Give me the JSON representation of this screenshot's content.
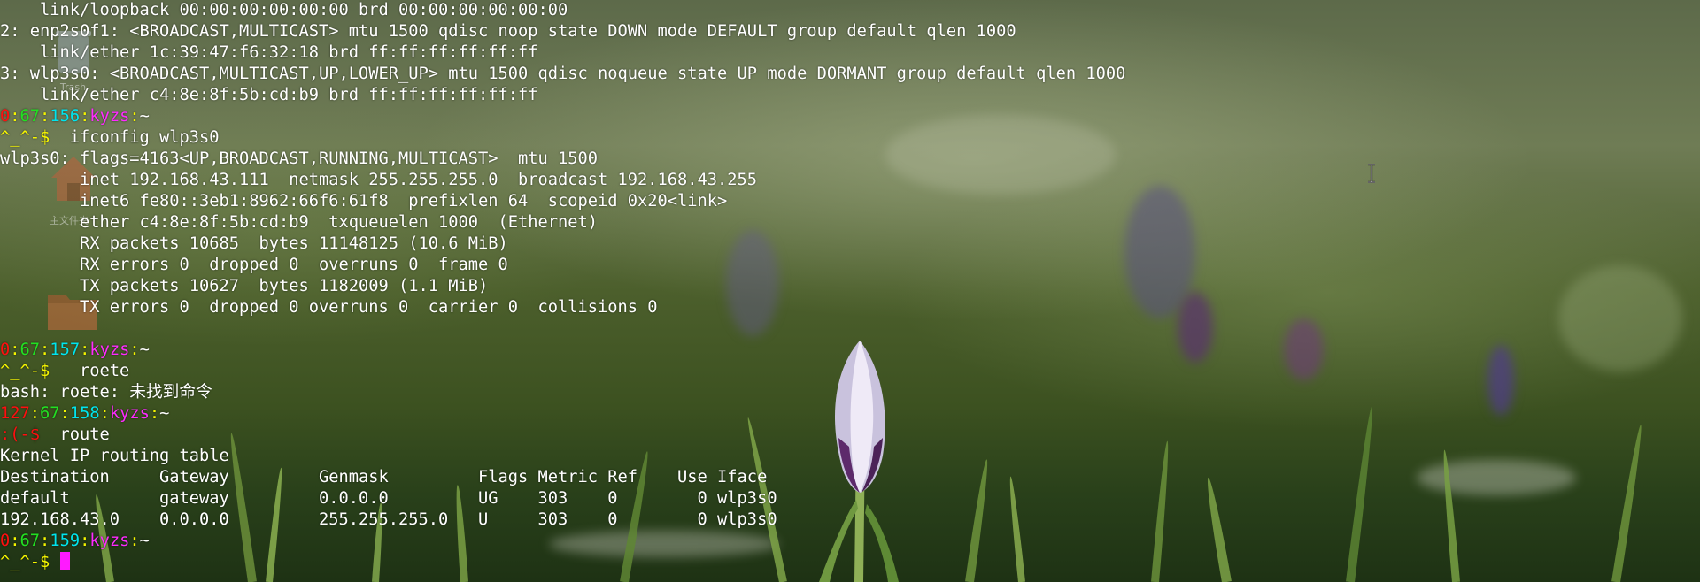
{
  "desktop": {
    "icons": [
      {
        "name": "trash-icon",
        "label": "Trash"
      },
      {
        "name": "home-folder-icon",
        "label": "主文件夹"
      },
      {
        "name": "folder-icon",
        "label": ""
      }
    ]
  },
  "prompt": {
    "host": "kyzs",
    "dir": "~",
    "sep": ":",
    "happy": "^_^-$",
    "sad": ":(-$"
  },
  "terminal": {
    "l0": "    link/loopback 00:00:00:00:00:00 brd 00:00:00:00:00:00",
    "l1": "2: enp2s0f1: <BROADCAST,MULTICAST> mtu 1500 qdisc noop state DOWN mode DEFAULT group default qlen 1000",
    "l2": "    link/ether 1c:39:47:f6:32:18 brd ff:ff:ff:ff:ff:ff",
    "l3": "3: wlp3s0: <BROADCAST,MULTICAST,UP,LOWER_UP> mtu 1500 qdisc noqueue state UP mode DORMANT group default qlen 1000",
    "l4": "    link/ether c4:8e:8f:5b:cd:b9 brd ff:ff:ff:ff:ff:ff",
    "p1": {
      "status": "0",
      "jobs": "67",
      "hist": "156"
    },
    "c1": "  ifconfig wlp3s0",
    "o1": "wlp3s0: flags=4163<UP,BROADCAST,RUNNING,MULTICAST>  mtu 1500",
    "o2": "        inet 192.168.43.111  netmask 255.255.255.0  broadcast 192.168.43.255",
    "o3": "        inet6 fe80::3eb1:8962:66f6:61f8  prefixlen 64  scopeid 0x20<link>",
    "o4": "        ether c4:8e:8f:5b:cd:b9  txqueuelen 1000  (Ethernet)",
    "o5": "        RX packets 10685  bytes 11148125 (10.6 MiB)",
    "o6": "        RX errors 0  dropped 0  overruns 0  frame 0",
    "o7": "        TX packets 10627  bytes 1182009 (1.1 MiB)",
    "o8": "        TX errors 0  dropped 0 overruns 0  carrier 0  collisions 0",
    "p2": {
      "status": "0",
      "jobs": "67",
      "hist": "157"
    },
    "c2": "   roete",
    "o9": "bash: roete: 未找到命令",
    "p3": {
      "status": "127",
      "jobs": "67",
      "hist": "158"
    },
    "c3": "  route",
    "r0": "Kernel IP routing table",
    "r1": "Destination     Gateway         Genmask         Flags Metric Ref    Use Iface",
    "r2": "default         gateway         0.0.0.0         UG    303    0        0 wlp3s0",
    "r3": "192.168.43.0    0.0.0.0         255.255.255.0   U     303    0        0 wlp3s0",
    "p4": {
      "status": "0",
      "jobs": "67",
      "hist": "159"
    },
    "c4": " "
  },
  "colors": {
    "status_ok": "#ff0f0f",
    "jobs": "#22e022",
    "history": "#00e5ee",
    "host": "#ff2bff",
    "happy_prompt": "#f6f600",
    "sad_prompt": "#ff0f0f",
    "cursor": "#ff1aff"
  }
}
